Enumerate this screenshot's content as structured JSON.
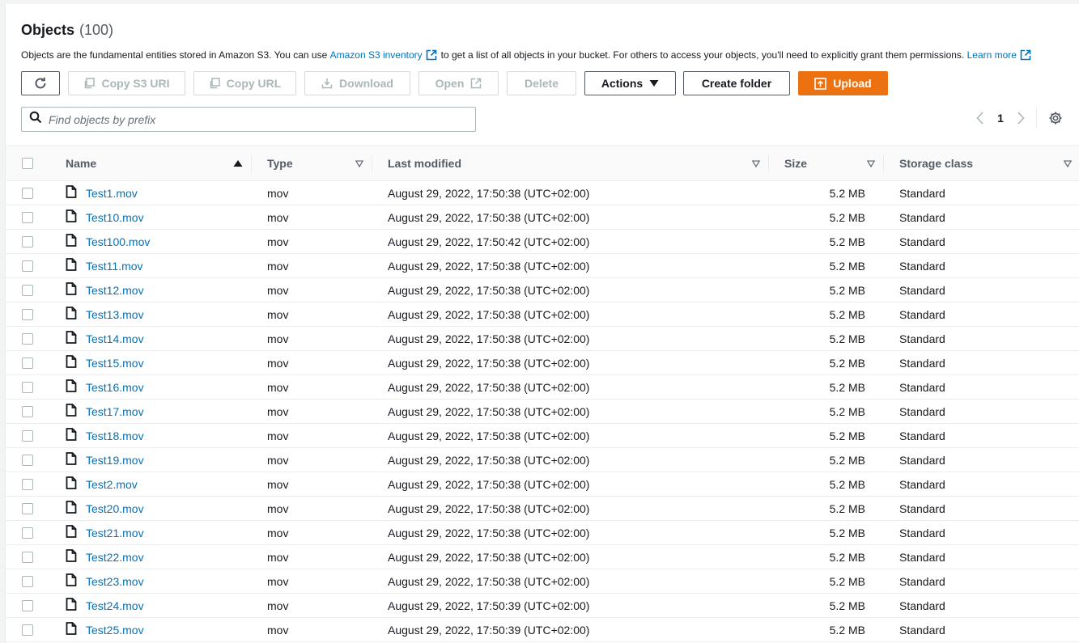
{
  "header": {
    "title": "Objects",
    "count": "(100)",
    "desc_before": "Objects are the fundamental entities stored in Amazon S3. You can use",
    "inventory_link": "Amazon S3 inventory",
    "desc_after": "to get a list of all objects in your bucket. For others to access your objects, you'll need to explicitly grant them permissions.",
    "learn_more": "Learn more"
  },
  "toolbar": {
    "copy_s3_uri": "Copy S3 URI",
    "copy_url": "Copy URL",
    "download": "Download",
    "open": "Open",
    "delete": "Delete",
    "actions": "Actions",
    "create_folder": "Create folder",
    "upload": "Upload"
  },
  "search": {
    "placeholder": "Find objects by prefix"
  },
  "pagination": {
    "current_page": "1"
  },
  "colors": {
    "link": "#0073bb",
    "primary": "#ec7211",
    "border": "#eaeded"
  },
  "table": {
    "columns": [
      "Name",
      "Type",
      "Last modified",
      "Size",
      "Storage class"
    ],
    "rows": [
      {
        "name": "Test1.mov",
        "type": "mov",
        "modified": "August 29, 2022, 17:50:38 (UTC+02:00)",
        "size": "5.2 MB",
        "storage": "Standard"
      },
      {
        "name": "Test10.mov",
        "type": "mov",
        "modified": "August 29, 2022, 17:50:38 (UTC+02:00)",
        "size": "5.2 MB",
        "storage": "Standard"
      },
      {
        "name": "Test100.mov",
        "type": "mov",
        "modified": "August 29, 2022, 17:50:42 (UTC+02:00)",
        "size": "5.2 MB",
        "storage": "Standard"
      },
      {
        "name": "Test11.mov",
        "type": "mov",
        "modified": "August 29, 2022, 17:50:38 (UTC+02:00)",
        "size": "5.2 MB",
        "storage": "Standard"
      },
      {
        "name": "Test12.mov",
        "type": "mov",
        "modified": "August 29, 2022, 17:50:38 (UTC+02:00)",
        "size": "5.2 MB",
        "storage": "Standard"
      },
      {
        "name": "Test13.mov",
        "type": "mov",
        "modified": "August 29, 2022, 17:50:38 (UTC+02:00)",
        "size": "5.2 MB",
        "storage": "Standard"
      },
      {
        "name": "Test14.mov",
        "type": "mov",
        "modified": "August 29, 2022, 17:50:38 (UTC+02:00)",
        "size": "5.2 MB",
        "storage": "Standard"
      },
      {
        "name": "Test15.mov",
        "type": "mov",
        "modified": "August 29, 2022, 17:50:38 (UTC+02:00)",
        "size": "5.2 MB",
        "storage": "Standard"
      },
      {
        "name": "Test16.mov",
        "type": "mov",
        "modified": "August 29, 2022, 17:50:38 (UTC+02:00)",
        "size": "5.2 MB",
        "storage": "Standard"
      },
      {
        "name": "Test17.mov",
        "type": "mov",
        "modified": "August 29, 2022, 17:50:38 (UTC+02:00)",
        "size": "5.2 MB",
        "storage": "Standard"
      },
      {
        "name": "Test18.mov",
        "type": "mov",
        "modified": "August 29, 2022, 17:50:38 (UTC+02:00)",
        "size": "5.2 MB",
        "storage": "Standard"
      },
      {
        "name": "Test19.mov",
        "type": "mov",
        "modified": "August 29, 2022, 17:50:38 (UTC+02:00)",
        "size": "5.2 MB",
        "storage": "Standard"
      },
      {
        "name": "Test2.mov",
        "type": "mov",
        "modified": "August 29, 2022, 17:50:38 (UTC+02:00)",
        "size": "5.2 MB",
        "storage": "Standard"
      },
      {
        "name": "Test20.mov",
        "type": "mov",
        "modified": "August 29, 2022, 17:50:38 (UTC+02:00)",
        "size": "5.2 MB",
        "storage": "Standard"
      },
      {
        "name": "Test21.mov",
        "type": "mov",
        "modified": "August 29, 2022, 17:50:38 (UTC+02:00)",
        "size": "5.2 MB",
        "storage": "Standard"
      },
      {
        "name": "Test22.mov",
        "type": "mov",
        "modified": "August 29, 2022, 17:50:38 (UTC+02:00)",
        "size": "5.2 MB",
        "storage": "Standard"
      },
      {
        "name": "Test23.mov",
        "type": "mov",
        "modified": "August 29, 2022, 17:50:38 (UTC+02:00)",
        "size": "5.2 MB",
        "storage": "Standard"
      },
      {
        "name": "Test24.mov",
        "type": "mov",
        "modified": "August 29, 2022, 17:50:39 (UTC+02:00)",
        "size": "5.2 MB",
        "storage": "Standard"
      },
      {
        "name": "Test25.mov",
        "type": "mov",
        "modified": "August 29, 2022, 17:50:39 (UTC+02:00)",
        "size": "5.2 MB",
        "storage": "Standard"
      }
    ]
  }
}
